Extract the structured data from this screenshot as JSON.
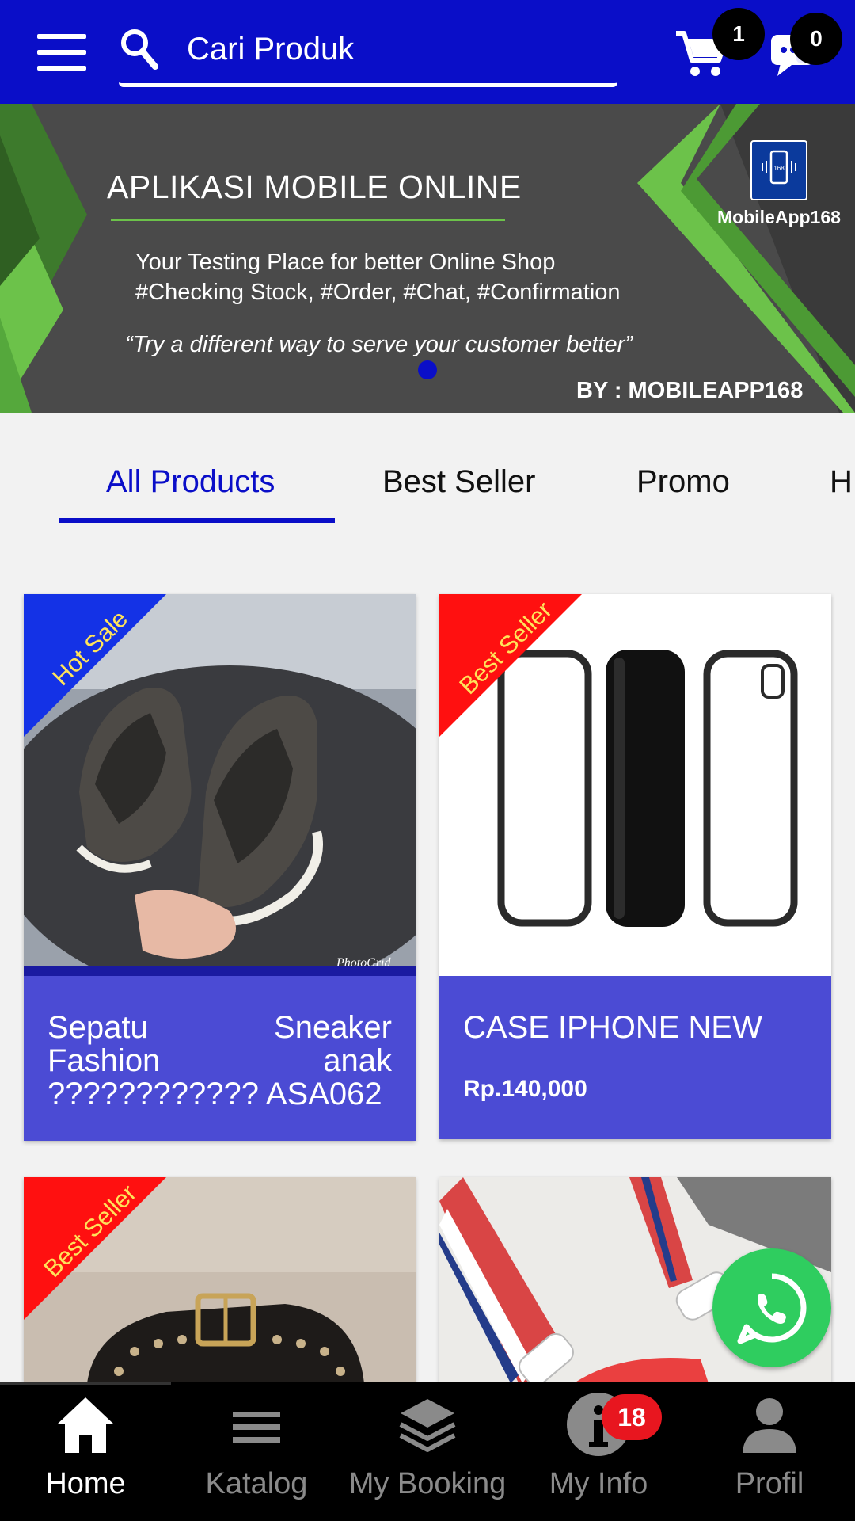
{
  "header": {
    "menu_icon": "hamburger-menu-icon",
    "search_icon": "search-icon",
    "search_placeholder": "Cari Produk",
    "cart_icon": "cart-icon",
    "cart_count": "1",
    "chat_icon": "chat-icon",
    "chat_count": "0",
    "color": "#0a0ec8"
  },
  "banner": {
    "title": "APLIKASI MOBILE ONLINE",
    "subtitle_line1": "Your Testing Place for better Online Shop",
    "subtitle_line2": "#Checking Stock, #Order, #Chat, #Confirmation",
    "quote": "“Try a different way to serve your customer better”",
    "byline": "BY : MOBILEAPP168",
    "brand": "MobileApp168",
    "logo_text": "168"
  },
  "tabs": [
    {
      "label": "All Products",
      "active": true
    },
    {
      "label": "Best Seller",
      "active": false
    },
    {
      "label": "Promo",
      "active": false
    },
    {
      "label": "H",
      "active": false
    }
  ],
  "products": [
    {
      "ribbon": "Hot Sale",
      "ribbon_color": "#1432e6",
      "name": "Sepatu Sneaker Fashion anak ???????????? ASA062",
      "price": "",
      "image_watermark": "PhotoGrid"
    },
    {
      "ribbon": "Best Seller",
      "ribbon_color": "#ff1010",
      "name": "CASE IPHONE NEW",
      "price": "Rp.140,000"
    },
    {
      "ribbon": "Best Seller",
      "ribbon_color": "#ff1010",
      "name": "",
      "price": ""
    },
    {
      "ribbon": "",
      "ribbon_color": "",
      "name": "",
      "price": ""
    }
  ],
  "fab": {
    "icon": "whatsapp-icon",
    "color": "#2fcd5f"
  },
  "bottom_nav": {
    "items": [
      {
        "label": "Home",
        "icon": "home-icon",
        "active": true
      },
      {
        "label": "Katalog",
        "icon": "list-icon",
        "active": false
      },
      {
        "label": "My Booking",
        "icon": "layers-icon",
        "active": false
      },
      {
        "label": "My Info",
        "icon": "info-icon",
        "active": false
      },
      {
        "label": "Profil",
        "icon": "person-icon",
        "active": false
      }
    ],
    "info_badge": "18"
  }
}
